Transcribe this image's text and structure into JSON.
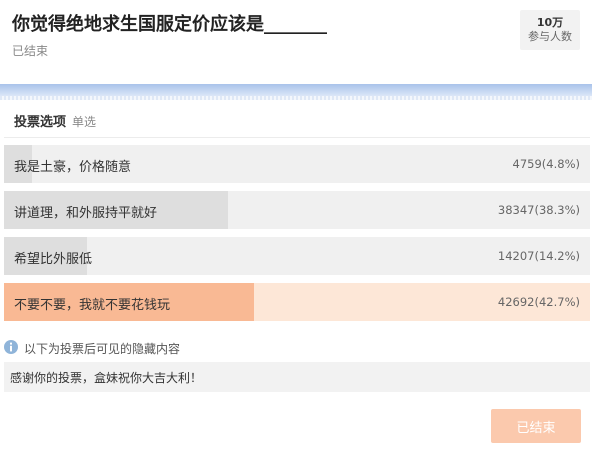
{
  "header": {
    "title": "你觉得绝地求生国服定价应该是_______",
    "status": "已结束",
    "participants": {
      "count": "10万",
      "label": "参与人数"
    }
  },
  "section": {
    "title": "投票选项",
    "type": "单选"
  },
  "options": [
    {
      "label": "我是土豪，价格随意",
      "votes": 4759,
      "percent": 4.8,
      "stat": "4759(4.8%)"
    },
    {
      "label": "讲道理，和外服持平就好",
      "votes": 38347,
      "percent": 38.3,
      "stat": "38347(38.3%)"
    },
    {
      "label": "希望比外服低",
      "votes": 14207,
      "percent": 14.2,
      "stat": "14207(14.2%)"
    },
    {
      "label": "不要不要，我就不要花钱玩",
      "votes": 42692,
      "percent": 42.7,
      "stat": "42692(42.7%)"
    }
  ],
  "hidden": {
    "icon": "info-icon",
    "label": "以下为投票后可见的隐藏内容",
    "content": "感谢你的投票，盒妹祝你大吉大利！"
  },
  "action": {
    "ended_label": "已结束"
  },
  "colors": {
    "accent": "#f9b994",
    "accent_light": "#fde7d7",
    "bar_fill": "#dedede",
    "bar_bg": "#f0f0f0",
    "info_icon": "#8fb4d9",
    "ended_button": "#fbc9ad"
  }
}
